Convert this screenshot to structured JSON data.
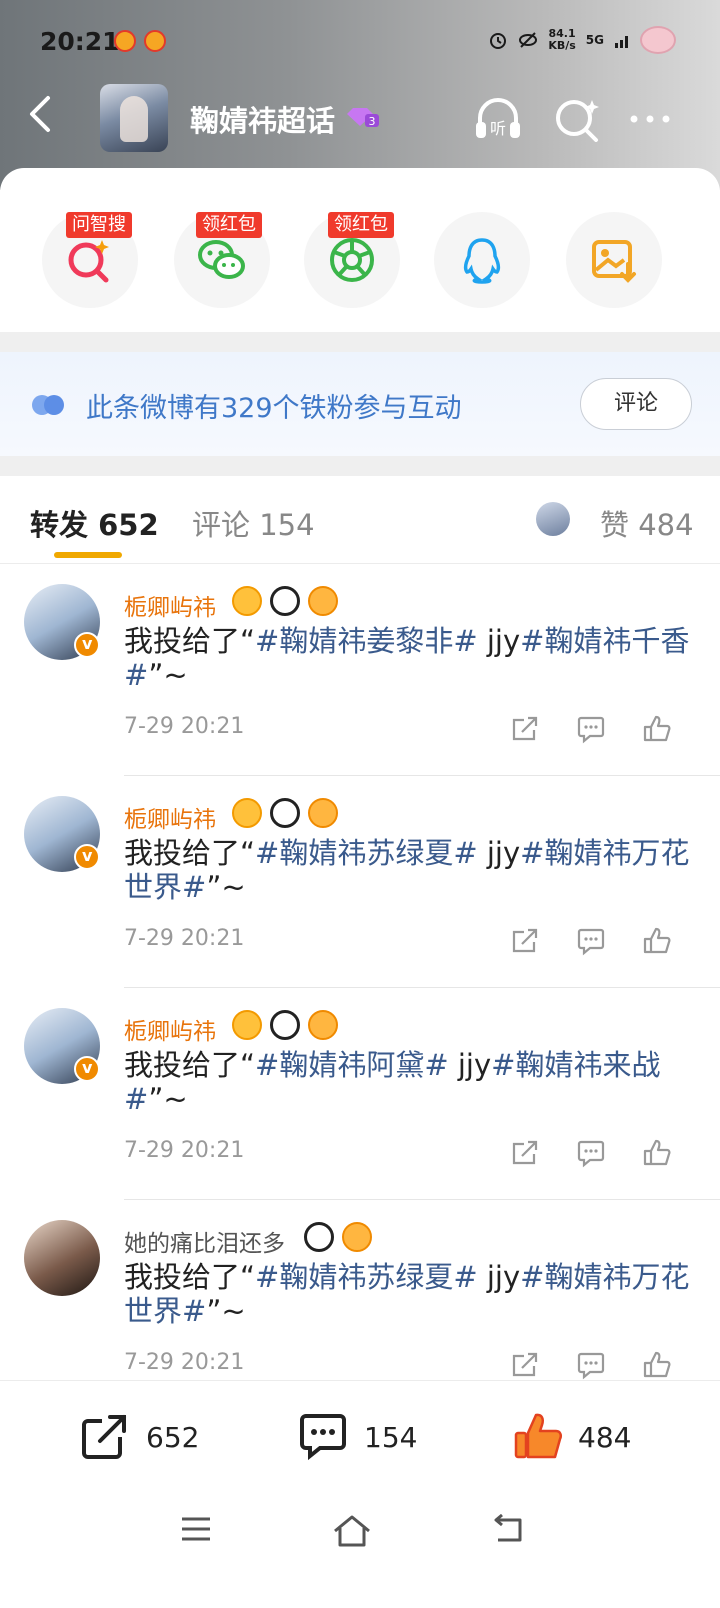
{
  "status": {
    "time": "20:21",
    "net_speed": "84.1\nKB/s",
    "network": "5G"
  },
  "header": {
    "title": "鞠婧祎超话"
  },
  "share": {
    "buttons": [
      {
        "name": "wenzhisou-button",
        "badge": "问智搜",
        "icon": "search-sparkle-icon",
        "color": "#f03a5a"
      },
      {
        "name": "wechat-share-button",
        "badge": "领红包",
        "icon": "wechat-icon",
        "color": "#3bb54a"
      },
      {
        "name": "moments-share-button",
        "badge": "领红包",
        "icon": "moments-icon",
        "color": "#3bb54a"
      },
      {
        "name": "qq-share-button",
        "badge": "",
        "icon": "qq-icon",
        "color": "#1fa3ef"
      },
      {
        "name": "save-image-button",
        "badge": "",
        "icon": "save-image-icon",
        "color": "#f2a626"
      }
    ]
  },
  "fans_banner": {
    "text": "此条微博有329个铁粉参与互动",
    "button": "评论"
  },
  "tabs": {
    "repost": "转发 652",
    "comment": "评论 154",
    "like": "赞 484"
  },
  "reposts": [
    {
      "name": "栀卿屿祎",
      "name_color": "orange",
      "verified": true,
      "badges": [
        "crown",
        "panda",
        "fish"
      ],
      "prefix": "我投给了“",
      "tag1": "#鞠婧祎姜黎非#",
      "mid": " jjy",
      "tag2": "#鞠婧祎千香#",
      "suffix": "”~",
      "time": "7-29 20:21"
    },
    {
      "name": "栀卿屿祎",
      "name_color": "orange",
      "verified": true,
      "badges": [
        "crown",
        "panda",
        "fish"
      ],
      "prefix": "我投给了“",
      "tag1": "#鞠婧祎苏绿夏#",
      "mid": " jjy",
      "tag2": "#鞠婧祎万花世界#",
      "suffix": "”~",
      "time": "7-29 20:21"
    },
    {
      "name": "栀卿屿祎",
      "name_color": "orange",
      "verified": true,
      "badges": [
        "crown",
        "panda",
        "fish"
      ],
      "prefix": "我投给了“",
      "tag1": "#鞠婧祎阿黛#",
      "mid": " jjy",
      "tag2": "#鞠婧祎来战#",
      "suffix": "”~",
      "time": "7-29 20:21"
    },
    {
      "name": "她的痛比泪还多",
      "name_color": "grey",
      "verified": false,
      "badges": [
        "panda",
        "fish"
      ],
      "prefix": "我投给了“",
      "tag1": "#鞠婧祎苏绿夏#",
      "mid": " jjy",
      "tag2": "#鞠婧祎万花世界#",
      "suffix": "”~",
      "time": "7-29 20:21"
    }
  ],
  "bottom_bar": {
    "repost": "652",
    "comment": "154",
    "like": "484"
  }
}
